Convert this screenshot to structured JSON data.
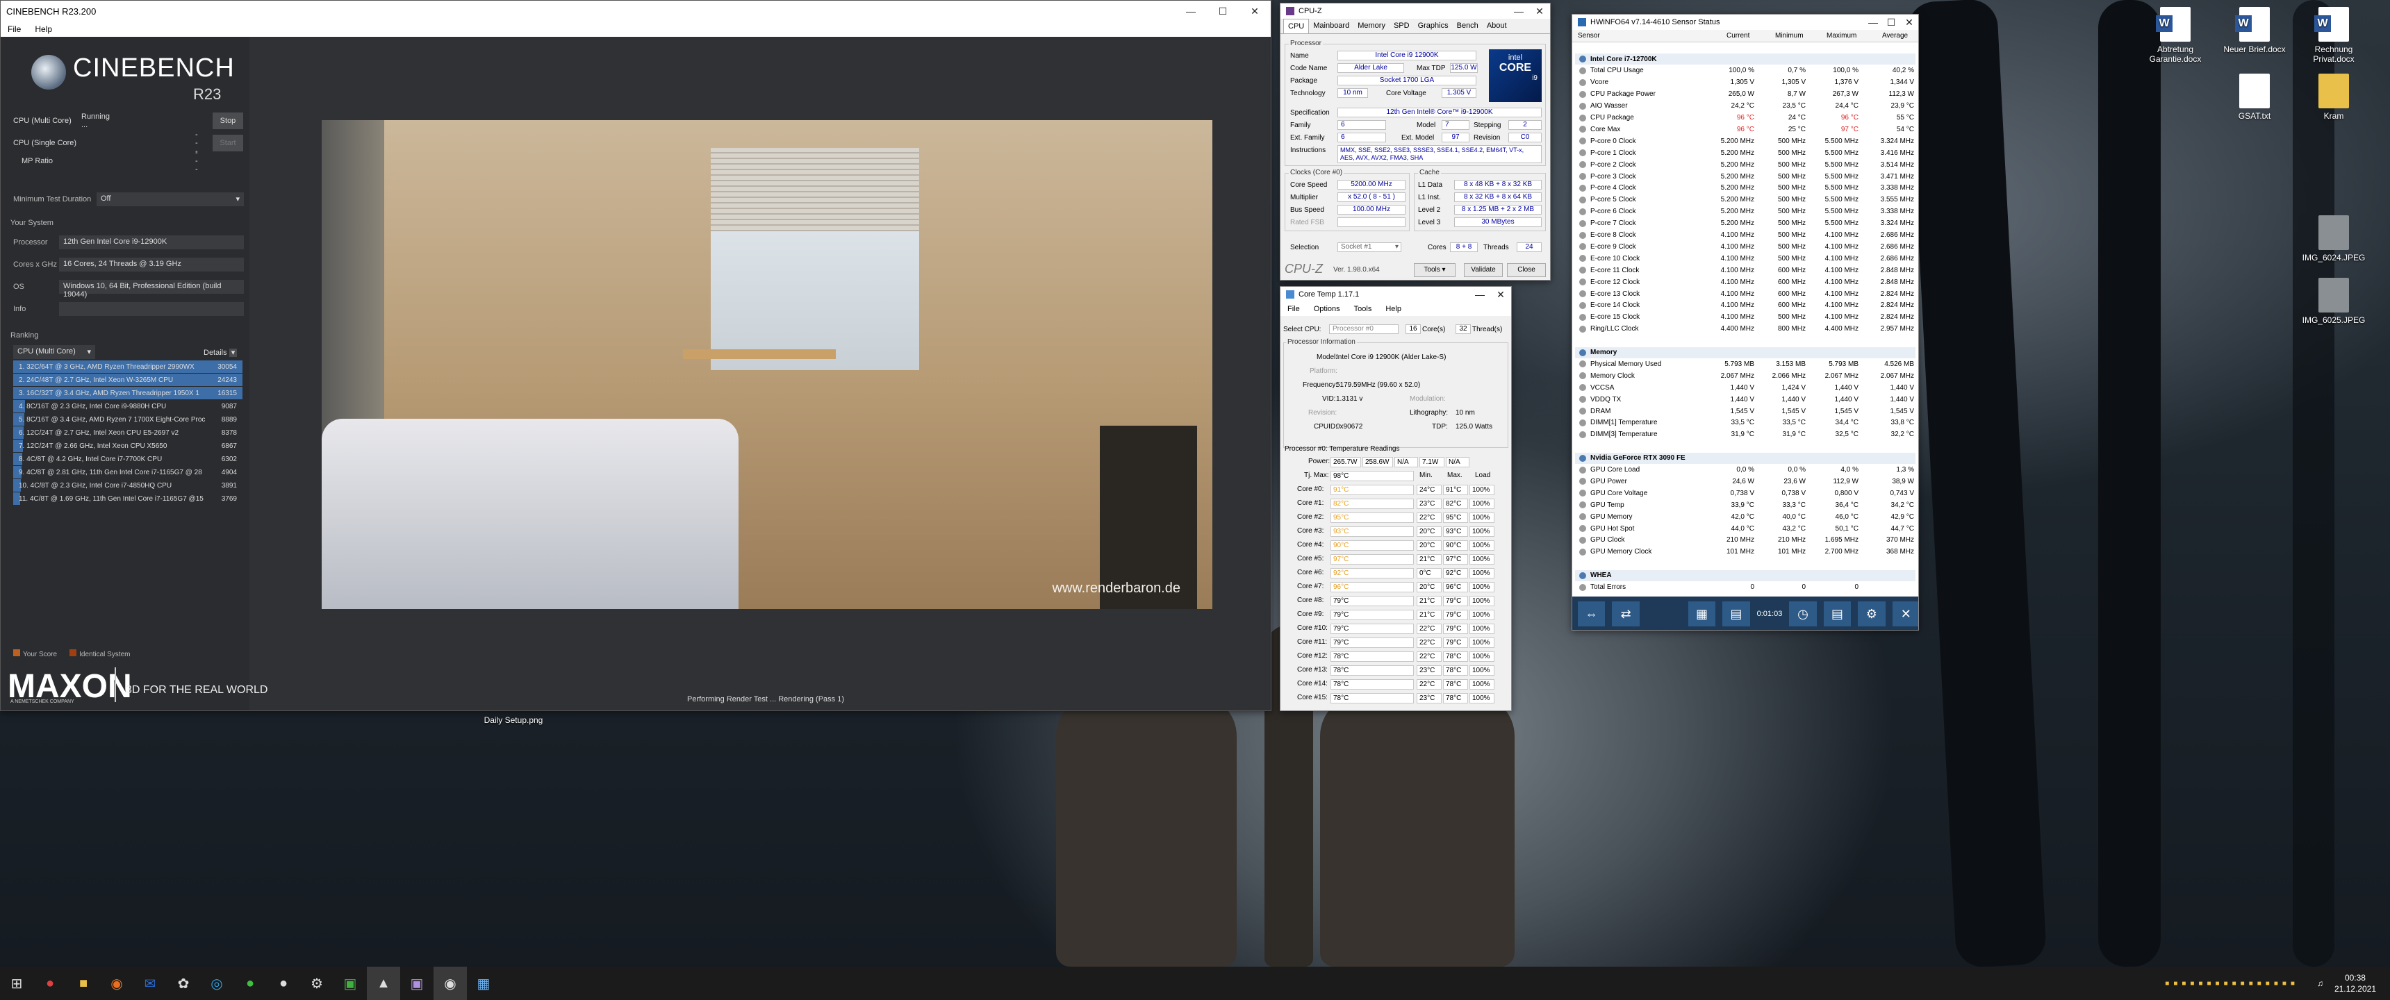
{
  "desktop": {
    "icons": [
      {
        "label": "Abtretung\nGarantie.docx"
      },
      {
        "label": "Neuer Brief.docx"
      },
      {
        "label": "Rechnung\nPrivat.docx"
      },
      {
        "label": "GSAT.txt"
      },
      {
        "label": "Kram"
      },
      {
        "label": "IMG_6024.JPEG"
      },
      {
        "label": "IMG_6025.JPEG"
      },
      {
        "label": "Daily Setup.png"
      }
    ]
  },
  "cinebench": {
    "title": "CINEBENCH R23.200",
    "menu": [
      "File",
      "Help"
    ],
    "brand": "CINEBENCH",
    "version": "R23",
    "tests": [
      {
        "label": "CPU (Multi Core)",
        "status": "Running ...",
        "button": "Stop"
      },
      {
        "label": "CPU (Single Core)",
        "status": "---",
        "button": "Start"
      },
      {
        "label": "MP Ratio",
        "status": "---",
        "button": ""
      }
    ],
    "min_test_label": "Minimum Test Duration",
    "min_test_value": "Off",
    "system_header": "Your System",
    "system": [
      {
        "k": "Processor",
        "v": "12th Gen Intel Core i9-12900K"
      },
      {
        "k": "Cores x GHz",
        "v": "16 Cores, 24 Threads @ 3.19 GHz"
      },
      {
        "k": "OS",
        "v": "Windows 10, 64 Bit, Professional Edition (build 19044)"
      },
      {
        "k": "Info",
        "v": ""
      }
    ],
    "ranking_header": "Ranking",
    "ranking_select": "CPU (Multi Core)",
    "details": "Details",
    "ranking": [
      {
        "label": "1. 32C/64T @ 3 GHz, AMD Ryzen Threadripper 2990WX",
        "value": "30054",
        "hl": true
      },
      {
        "label": "2. 24C/48T @ 2.7 GHz, Intel Xeon W-3265M CPU",
        "value": "24243",
        "hl": true
      },
      {
        "label": "3. 16C/32T @ 3.4 GHz, AMD Ryzen Threadripper 1950X 1",
        "value": "16315",
        "hl": true
      },
      {
        "label": "4. 8C/16T @ 2.3 GHz, Intel Core i9-9880H CPU",
        "value": "9087",
        "hl": false
      },
      {
        "label": "5. 8C/16T @ 3.4 GHz, AMD Ryzen 7 1700X Eight-Core Proc",
        "value": "8889",
        "hl": false
      },
      {
        "label": "6. 12C/24T @ 2.7 GHz, Intel Xeon CPU E5-2697 v2",
        "value": "8378",
        "hl": false
      },
      {
        "label": "7. 12C/24T @ 2.66 GHz, Intel Xeon CPU X5650",
        "value": "6867",
        "hl": false
      },
      {
        "label": "8. 4C/8T @ 4.2 GHz, Intel Core i7-7700K CPU",
        "value": "6302",
        "hl": false
      },
      {
        "label": "9. 4C/8T @ 2.81 GHz, 11th Gen Intel Core i7-1165G7 @ 28",
        "value": "4904",
        "hl": false
      },
      {
        "label": "10. 4C/8T @ 2.3 GHz, Intel Core i7-4850HQ CPU",
        "value": "3891",
        "hl": false
      },
      {
        "label": "11. 4C/8T @ 1.69 GHz, 11th Gen Intel Core i7-1165G7 @15",
        "value": "3769",
        "hl": false
      }
    ],
    "legend": [
      "Your Score",
      "Identical System"
    ],
    "maxon": "MAXON",
    "maxon_sub": "A NEMETSCHEK COMPANY",
    "tagline": "3D FOR THE REAL WORLD",
    "status": "Performing Render Test ... Rendering (Pass 1)",
    "watermark": "www.renderbaron.de"
  },
  "cpuz": {
    "title": "CPU-Z",
    "tabs": [
      "CPU",
      "Mainboard",
      "Memory",
      "SPD",
      "Graphics",
      "Bench",
      "About"
    ],
    "proc_group": "Processor",
    "name": "Intel Core i9 12900K",
    "codename": "Alder Lake",
    "maxtdp": "125.0 W",
    "package": "Socket 1700 LGA",
    "technology": "10 nm",
    "core_voltage": "1.305 V",
    "spec": "12th Gen Intel® Core™ i9-12900K",
    "family": "6",
    "model": "7",
    "stepping": "2",
    "ext_family": "6",
    "ext_model": "97",
    "revision": "C0",
    "instructions": "MMX, SSE, SSE2, SSE3, SSSE3, SSE4.1, SSE4.2, EM64T, VT-x, AES, AVX, AVX2, FMA3, SHA",
    "clocks_group": "Clocks (Core #0)",
    "cache_group": "Cache",
    "core_speed": "5200.00 MHz",
    "multiplier": "x 52.0 ( 8 - 51 )",
    "bus_speed": "100.00 MHz",
    "rated_fsb": "",
    "l1d": "8 x 48 KB + 8 x 32 KB",
    "l1i": "8 x 32 KB + 8 x 64 KB",
    "l2": "8 x 1.25 MB + 2 x 2 MB",
    "l3": "30 MBytes",
    "selection": "Socket #1",
    "cores": "8 + 8",
    "threads": "24",
    "version": "Ver. 1.98.0.x64",
    "tools": "Tools",
    "validate": "Validate",
    "close": "Close",
    "labels": {
      "name": "Name",
      "codename": "Code Name",
      "maxtdp": "Max TDP",
      "package": "Package",
      "technology": "Technology",
      "core_voltage": "Core Voltage",
      "spec": "Specification",
      "family": "Family",
      "model": "Model",
      "stepping": "Stepping",
      "ext_family": "Ext. Family",
      "ext_model": "Ext. Model",
      "revision": "Revision",
      "instructions": "Instructions",
      "core_speed": "Core Speed",
      "multiplier": "Multiplier",
      "bus_speed": "Bus Speed",
      "rated_fsb": "Rated FSB",
      "l1d": "L1 Data",
      "l1i": "L1 Inst.",
      "l2": "Level 2",
      "l3": "Level 3",
      "selection": "Selection",
      "cores": "Cores",
      "threads": "Threads"
    },
    "logo_brand": "intel",
    "logo_core": "CORE",
    "logo_tier": "i9"
  },
  "coretemp": {
    "title": "Core Temp 1.17.1",
    "menu": [
      "File",
      "Options",
      "Tools",
      "Help"
    ],
    "select_cpu": "Select CPU:",
    "cpu": "Processor #0",
    "cores": "16",
    "cores_label": "Core(s)",
    "threads": "32",
    "threads_label": "Thread(s)",
    "info_header": "Processor Information",
    "model_label": "Model:",
    "model": "Intel Core i9 12900K (Alder Lake-S)",
    "platform_label": "Platform:",
    "freq_label": "Frequency:",
    "freq": "5179.59MHz (99.60 x 52.0)",
    "vid_label": "VID:",
    "vid": "1.3131 v",
    "mod_label": "Modulation:",
    "rev_label": "Revision:",
    "lith_label": "Lithography:",
    "lith": "10 nm",
    "cpuid_label": "CPUID:",
    "cpuid": "0x90672",
    "tdp_label": "TDP:",
    "tdp": "125.0 Watts",
    "readings_header": "Processor #0: Temperature Readings",
    "power_label": "Power:",
    "power": [
      "265.7W",
      "258.6W",
      "N/A",
      "7.1W",
      "N/A"
    ],
    "tjmax_label": "Tj. Max:",
    "tjmax": "98°C",
    "cols": [
      "Min.",
      "Max.",
      "Load"
    ],
    "cores_rows": [
      {
        "n": "Core #0:",
        "t": "91°C",
        "min": "24°C",
        "max": "91°C",
        "load": "100%"
      },
      {
        "n": "Core #1:",
        "t": "82°C",
        "min": "23°C",
        "max": "82°C",
        "load": "100%"
      },
      {
        "n": "Core #2:",
        "t": "95°C",
        "min": "22°C",
        "max": "95°C",
        "load": "100%"
      },
      {
        "n": "Core #3:",
        "t": "93°C",
        "min": "20°C",
        "max": "93°C",
        "load": "100%"
      },
      {
        "n": "Core #4:",
        "t": "90°C",
        "min": "20°C",
        "max": "90°C",
        "load": "100%"
      },
      {
        "n": "Core #5:",
        "t": "97°C",
        "min": "21°C",
        "max": "97°C",
        "load": "100%"
      },
      {
        "n": "Core #6:",
        "t": "92°C",
        "min": "0°C",
        "max": "92°C",
        "load": "100%"
      },
      {
        "n": "Core #7:",
        "t": "96°C",
        "min": "20°C",
        "max": "96°C",
        "load": "100%"
      },
      {
        "n": "Core #8:",
        "t": "79°C",
        "min": "21°C",
        "max": "79°C",
        "load": "100%"
      },
      {
        "n": "Core #9:",
        "t": "79°C",
        "min": "21°C",
        "max": "79°C",
        "load": "100%"
      },
      {
        "n": "Core #10:",
        "t": "79°C",
        "min": "22°C",
        "max": "79°C",
        "load": "100%"
      },
      {
        "n": "Core #11:",
        "t": "79°C",
        "min": "22°C",
        "max": "79°C",
        "load": "100%"
      },
      {
        "n": "Core #12:",
        "t": "78°C",
        "min": "22°C",
        "max": "78°C",
        "load": "100%"
      },
      {
        "n": "Core #13:",
        "t": "78°C",
        "min": "23°C",
        "max": "78°C",
        "load": "100%"
      },
      {
        "n": "Core #14:",
        "t": "78°C",
        "min": "22°C",
        "max": "78°C",
        "load": "100%"
      },
      {
        "n": "Core #15:",
        "t": "78°C",
        "min": "23°C",
        "max": "78°C",
        "load": "100%"
      }
    ]
  },
  "hwinfo": {
    "title": "HWiNFO64 v7.14-4610 Sensor Status",
    "headers": [
      "Sensor",
      "Current",
      "Minimum",
      "Maximum",
      "Average"
    ],
    "rows": [
      {
        "n": "Intel Core i7-12700K",
        "g": true
      },
      {
        "n": "Total CPU Usage",
        "c": "100,0 %",
        "mi": "0,7 %",
        "ma": "100,0 %",
        "av": "40,2 %"
      },
      {
        "n": "Vcore",
        "c": "1,305 V",
        "mi": "1,305 V",
        "ma": "1,376 V",
        "av": "1,344 V"
      },
      {
        "n": "CPU Package Power",
        "c": "265,0 W",
        "mi": "8,7 W",
        "ma": "267,3 W",
        "av": "112,3 W"
      },
      {
        "n": "AIO Wasser",
        "c": "24,2 °C",
        "mi": "23,5 °C",
        "ma": "24,4 °C",
        "av": "23,9 °C"
      },
      {
        "n": "CPU Package",
        "c": "96 °C",
        "mi": "24 °C",
        "ma": "96 °C",
        "av": "55 °C",
        "red": true
      },
      {
        "n": "Core Max",
        "c": "96 °C",
        "mi": "25 °C",
        "ma": "97 °C",
        "av": "54 °C",
        "red": true
      },
      {
        "n": "P-core 0 Clock",
        "c": "5.200 MHz",
        "mi": "500 MHz",
        "ma": "5.500 MHz",
        "av": "3.324 MHz"
      },
      {
        "n": "P-core 1 Clock",
        "c": "5.200 MHz",
        "mi": "500 MHz",
        "ma": "5.500 MHz",
        "av": "3.416 MHz"
      },
      {
        "n": "P-core 2 Clock",
        "c": "5.200 MHz",
        "mi": "500 MHz",
        "ma": "5.500 MHz",
        "av": "3.514 MHz"
      },
      {
        "n": "P-core 3 Clock",
        "c": "5.200 MHz",
        "mi": "500 MHz",
        "ma": "5.500 MHz",
        "av": "3.471 MHz"
      },
      {
        "n": "P-core 4 Clock",
        "c": "5.200 MHz",
        "mi": "500 MHz",
        "ma": "5.500 MHz",
        "av": "3.338 MHz"
      },
      {
        "n": "P-core 5 Clock",
        "c": "5.200 MHz",
        "mi": "500 MHz",
        "ma": "5.500 MHz",
        "av": "3.555 MHz"
      },
      {
        "n": "P-core 6 Clock",
        "c": "5.200 MHz",
        "mi": "500 MHz",
        "ma": "5.500 MHz",
        "av": "3.338 MHz"
      },
      {
        "n": "P-core 7 Clock",
        "c": "5.200 MHz",
        "mi": "500 MHz",
        "ma": "5.500 MHz",
        "av": "3.324 MHz"
      },
      {
        "n": "E-core 8 Clock",
        "c": "4.100 MHz",
        "mi": "500 MHz",
        "ma": "4.100 MHz",
        "av": "2.686 MHz"
      },
      {
        "n": "E-core 9 Clock",
        "c": "4.100 MHz",
        "mi": "500 MHz",
        "ma": "4.100 MHz",
        "av": "2.686 MHz"
      },
      {
        "n": "E-core 10 Clock",
        "c": "4.100 MHz",
        "mi": "500 MHz",
        "ma": "4.100 MHz",
        "av": "2.686 MHz"
      },
      {
        "n": "E-core 11 Clock",
        "c": "4.100 MHz",
        "mi": "600 MHz",
        "ma": "4.100 MHz",
        "av": "2.848 MHz"
      },
      {
        "n": "E-core 12 Clock",
        "c": "4.100 MHz",
        "mi": "600 MHz",
        "ma": "4.100 MHz",
        "av": "2.848 MHz"
      },
      {
        "n": "E-core 13 Clock",
        "c": "4.100 MHz",
        "mi": "600 MHz",
        "ma": "4.100 MHz",
        "av": "2.824 MHz"
      },
      {
        "n": "E-core 14 Clock",
        "c": "4.100 MHz",
        "mi": "600 MHz",
        "ma": "4.100 MHz",
        "av": "2.824 MHz"
      },
      {
        "n": "E-core 15 Clock",
        "c": "4.100 MHz",
        "mi": "500 MHz",
        "ma": "4.100 MHz",
        "av": "2.824 MHz"
      },
      {
        "n": "Ring/LLC Clock",
        "c": "4.400 MHz",
        "mi": "800 MHz",
        "ma": "4.400 MHz",
        "av": "2.957 MHz"
      },
      {
        "n": "",
        "sp": true
      },
      {
        "n": "Memory",
        "g": true
      },
      {
        "n": "Physical Memory Used",
        "c": "5.793 MB",
        "mi": "3.153 MB",
        "ma": "5.793 MB",
        "av": "4.526 MB"
      },
      {
        "n": "Memory Clock",
        "c": "2.067 MHz",
        "mi": "2.066 MHz",
        "ma": "2.067 MHz",
        "av": "2.067 MHz"
      },
      {
        "n": "VCCSA",
        "c": "1,440 V",
        "mi": "1,424 V",
        "ma": "1,440 V",
        "av": "1,440 V"
      },
      {
        "n": "VDDQ TX",
        "c": "1,440 V",
        "mi": "1,440 V",
        "ma": "1,440 V",
        "av": "1,440 V"
      },
      {
        "n": "DRAM",
        "c": "1,545 V",
        "mi": "1,545 V",
        "ma": "1,545 V",
        "av": "1,545 V"
      },
      {
        "n": "DIMM[1] Temperature",
        "c": "33,5 °C",
        "mi": "33,5 °C",
        "ma": "34,4 °C",
        "av": "33,8 °C"
      },
      {
        "n": "DIMM[3] Temperature",
        "c": "31,9 °C",
        "mi": "31,9 °C",
        "ma": "32,5 °C",
        "av": "32,2 °C"
      },
      {
        "n": "",
        "sp": true
      },
      {
        "n": "Nvidia GeForce RTX 3090 FE",
        "g": true
      },
      {
        "n": "GPU Core Load",
        "c": "0,0 %",
        "mi": "0,0 %",
        "ma": "4,0 %",
        "av": "1,3 %"
      },
      {
        "n": "GPU Power",
        "c": "24,6 W",
        "mi": "23,6 W",
        "ma": "112,9 W",
        "av": "38,9 W"
      },
      {
        "n": "GPU Core Voltage",
        "c": "0,738 V",
        "mi": "0,738 V",
        "ma": "0,800 V",
        "av": "0,743 V"
      },
      {
        "n": "GPU Temp",
        "c": "33,9 °C",
        "mi": "33,3 °C",
        "ma": "36,4 °C",
        "av": "34,2 °C"
      },
      {
        "n": "GPU Memory",
        "c": "42,0 °C",
        "mi": "40,0 °C",
        "ma": "46,0 °C",
        "av": "42,9 °C"
      },
      {
        "n": "GPU Hot Spot",
        "c": "44,0 °C",
        "mi": "43,2 °C",
        "ma": "50,1 °C",
        "av": "44,7 °C"
      },
      {
        "n": "GPU Clock",
        "c": "210 MHz",
        "mi": "210 MHz",
        "ma": "1.695 MHz",
        "av": "370 MHz"
      },
      {
        "n": "GPU Memory Clock",
        "c": "101 MHz",
        "mi": "101 MHz",
        "ma": "2.700 MHz",
        "av": "368 MHz"
      },
      {
        "n": "",
        "sp": true
      },
      {
        "n": "WHEA",
        "g": true
      },
      {
        "n": "Total Errors",
        "c": "0",
        "mi": "0",
        "ma": "0",
        "av": ""
      }
    ],
    "timer": "0:01:03"
  },
  "taskbar": {
    "time": "00:38",
    "date": "21.12.2021"
  }
}
